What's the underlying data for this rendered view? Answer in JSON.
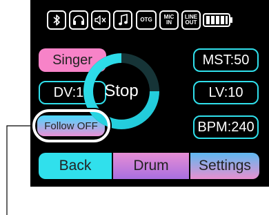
{
  "status_bar": {
    "icons": [
      "more-icon",
      "bluetooth-icon",
      "headphones-icon",
      "mute-icon",
      "music-icon"
    ],
    "otg": "OTG",
    "mic_in_line1": "MIC",
    "mic_in_line2": "IN",
    "line_out_line1": "LINE",
    "line_out_line2": "OUT",
    "battery_level": 1.0
  },
  "controls": {
    "singer": "Singer",
    "dv": "DV:10",
    "follow": "Follow OFF",
    "stop": "Stop",
    "mst": "MST:50",
    "lv": "LV:10",
    "bpm": "BPM:240"
  },
  "tabs": {
    "back": "Back",
    "drum": "Drum",
    "settings": "Settings"
  },
  "colors": {
    "accent_cyan": "#30e0ec",
    "pink": "#f783c8",
    "background": "#000000"
  }
}
